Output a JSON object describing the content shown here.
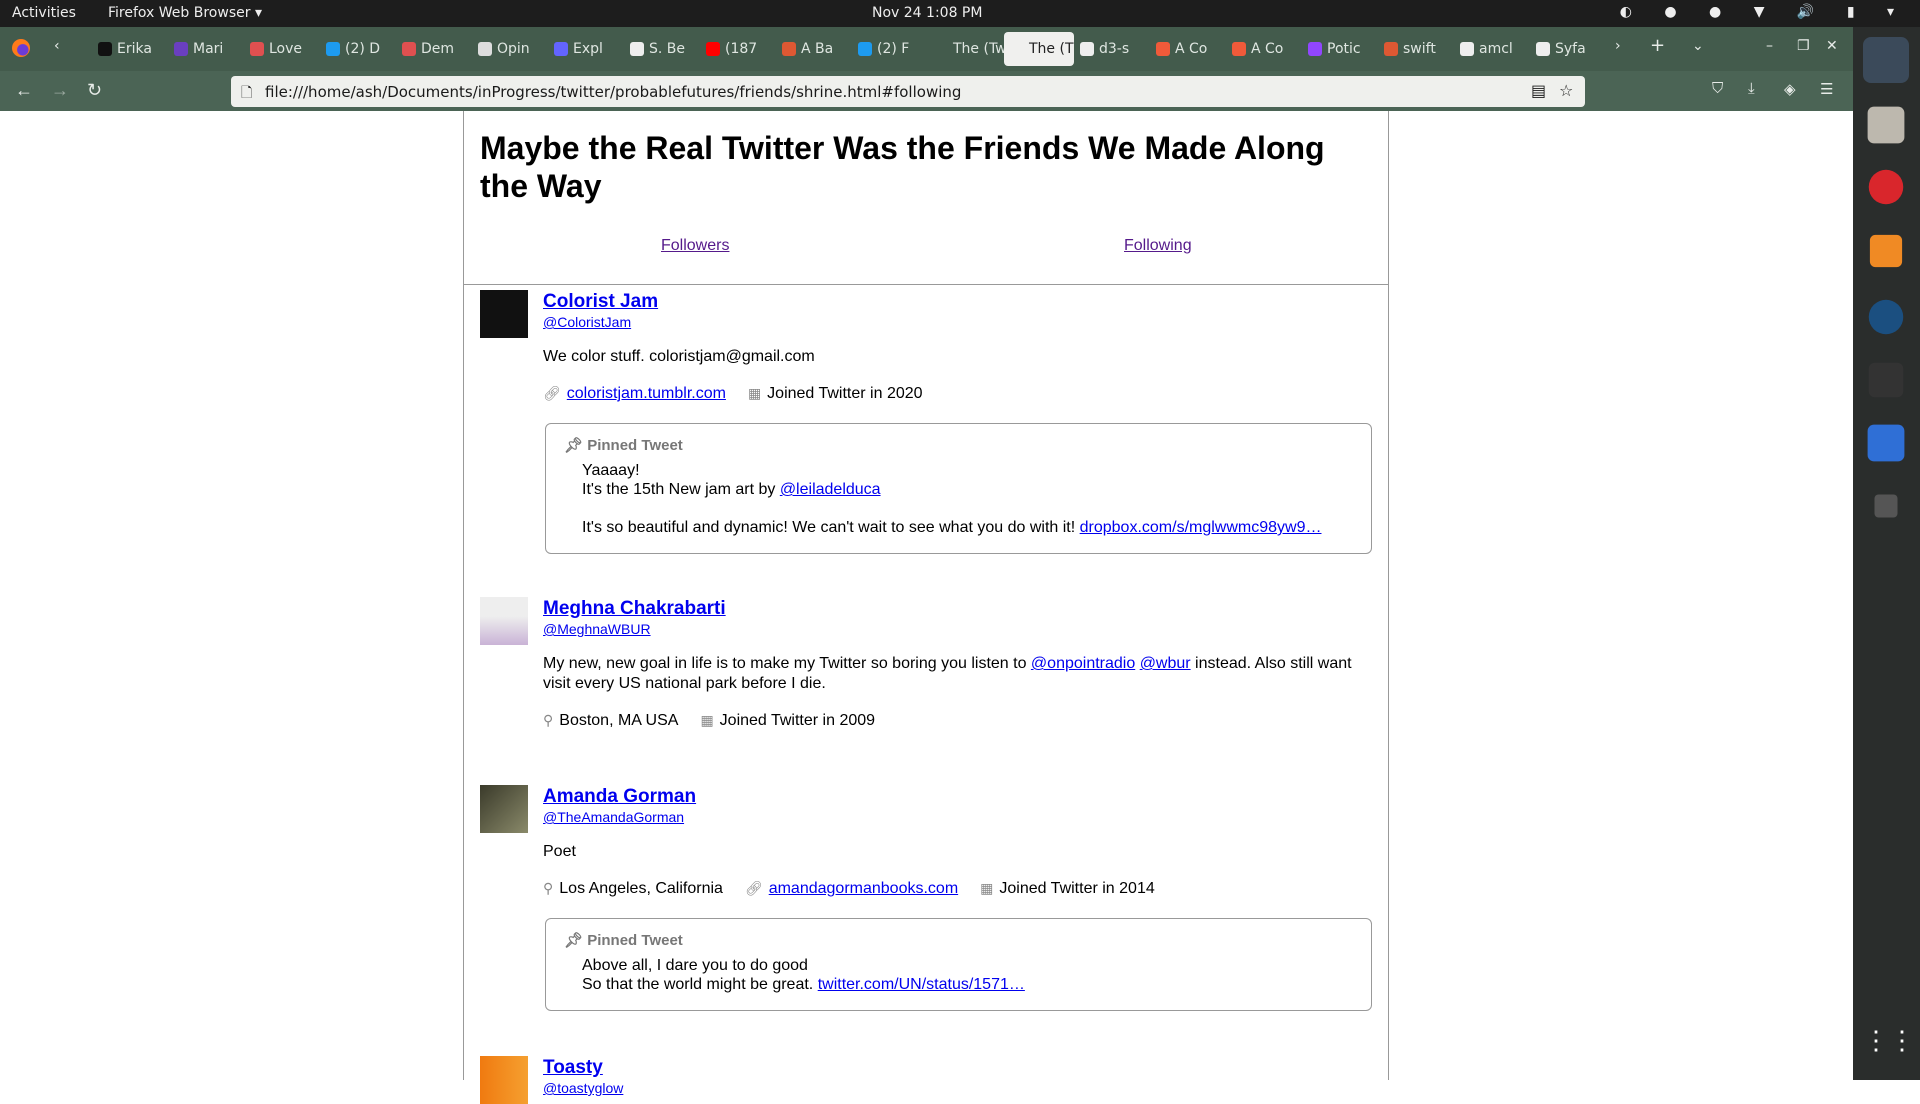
{
  "topbar": {
    "activities": "Activities",
    "app": "Firefox Web Browser ▾",
    "clock": "Nov 24  1:08 PM"
  },
  "tabs": [
    {
      "label": "Erika",
      "color": "#111"
    },
    {
      "label": "Mari",
      "color": "#6a3fc0"
    },
    {
      "label": "Love",
      "color": "#e05050"
    },
    {
      "label": "(2) D",
      "color": "#1d9bf0"
    },
    {
      "label": "Dem",
      "color": "#e05050"
    },
    {
      "label": "Opin",
      "color": "#ddd"
    },
    {
      "label": "Expl",
      "color": "#6364ff"
    },
    {
      "label": "S. Be",
      "color": "#eee"
    },
    {
      "label": "(187",
      "color": "#f00"
    },
    {
      "label": "A Ba",
      "color": "#de5833"
    },
    {
      "label": "(2) F",
      "color": "#1d9bf0"
    },
    {
      "label": "The (Tw",
      "color": "transparent"
    },
    {
      "label": "The (T",
      "color": "transparent",
      "active": true
    },
    {
      "label": "d3-s",
      "color": "#eee"
    },
    {
      "label": "A Co",
      "color": "#f05a3a"
    },
    {
      "label": "A Co",
      "color": "#f05a3a"
    },
    {
      "label": "Potic",
      "color": "#9146ff"
    },
    {
      "label": "swift",
      "color": "#de5833"
    },
    {
      "label": "amcl",
      "color": "#eee"
    },
    {
      "label": "Syfa",
      "color": "#eee"
    }
  ],
  "url": "file:///home/ash/Documents/inProgress/twitter/probablefutures/friends/shrine.html#following",
  "page": {
    "title": "Maybe the Real Twitter Was the Friends We Made Along the Way",
    "followers": "Followers",
    "following": "Following",
    "pinned_label": "Pinned Tweet",
    "entries": [
      {
        "name": "Colorist Jam",
        "handle": "@ColoristJam",
        "bio": "We color stuff. coloristjam@gmail.com",
        "website": "coloristjam.tumblr.com",
        "joined": "Joined Twitter in 2020",
        "avatar": "#111",
        "pin": {
          "l1": "Yaaaay!",
          "l2": "It's the 15th New jam art by ",
          "l2link": "@leiladelduca",
          "l3": "It's so beautiful and dynamic! We can't wait to see what you do with it! ",
          "l3link": "dropbox.com/s/mglwwmc98yw9…"
        }
      },
      {
        "name": "Meghna Chakrabarti",
        "handle": "@MeghnaWBUR",
        "bio1": "My new, new goal in life is to make my Twitter so boring you listen to ",
        "m1": "@onpointradio",
        "m2": "@wbur",
        "bio2": " instead. Also still want visit every US national park before I die.",
        "location": "Boston, MA USA",
        "joined": "Joined Twitter in 2009",
        "avatar": "#c9b3d6"
      },
      {
        "name": "Amanda Gorman",
        "handle": "@TheAmandaGorman",
        "bio": "Poet",
        "location": "Los Angeles, California",
        "website": "amandagormanbooks.com",
        "joined": "Joined Twitter in 2014",
        "avatar": "#6b6a4a",
        "pin": {
          "l1": "Above all, I dare you to do good",
          "l2": "So that the world might be great. ",
          "l2link": "twitter.com/UN/status/1571…"
        }
      },
      {
        "name": "Toasty",
        "handle": "@toastyglow",
        "avatar": "#f07a10"
      }
    ]
  }
}
